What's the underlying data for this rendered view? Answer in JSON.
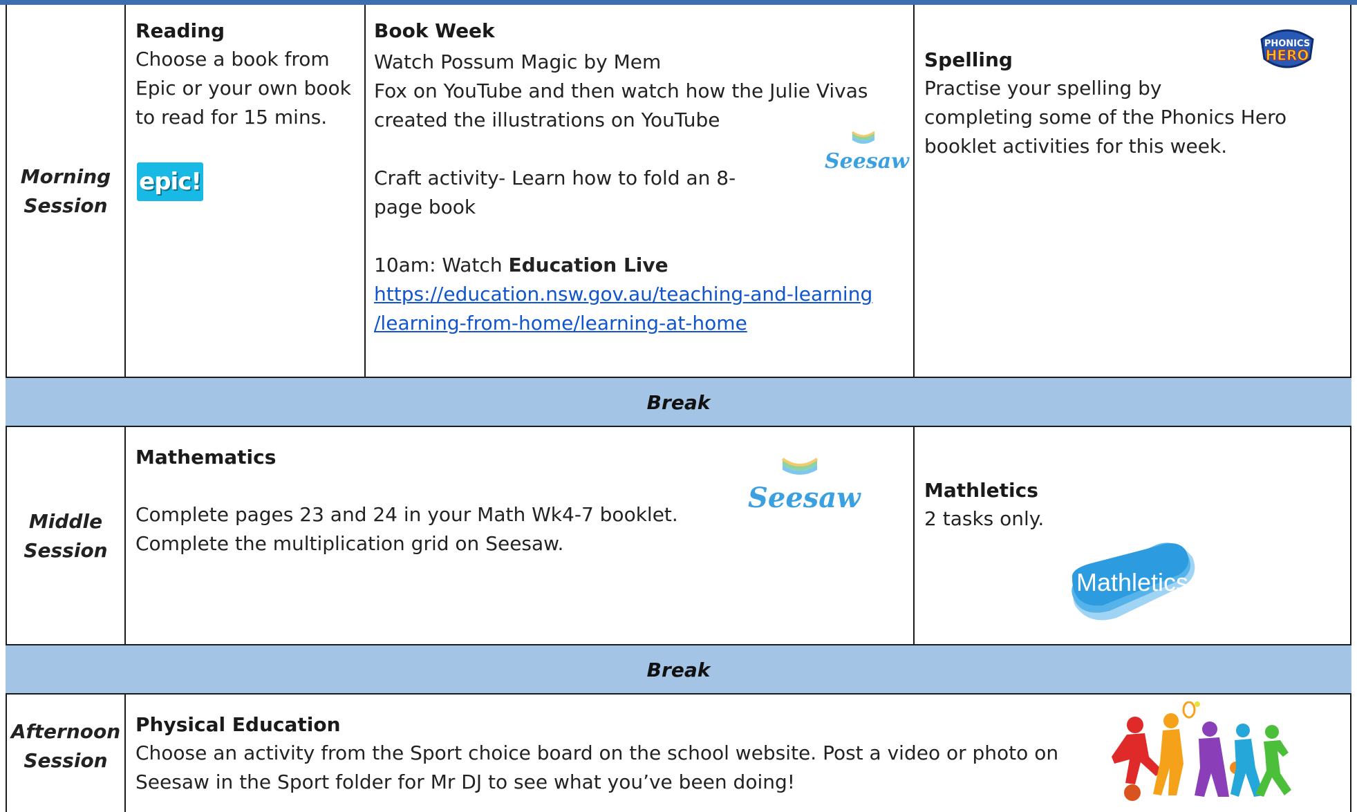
{
  "rows": {
    "morning": {
      "session_label": [
        "Morning",
        "Session"
      ],
      "reading": {
        "heading": "Reading",
        "lines": [
          "Choose a book from",
          "Epic or your own book",
          "to read for 15 mins."
        ],
        "logo_text": "epic!"
      },
      "book_week": {
        "heading": "Book Week",
        "para1": [
          "Watch Possum Magic by Mem",
          "Fox on YouTube and then watch how the Julie Vivas",
          "created the illustrations on YouTube"
        ],
        "para2": [
          "Craft activity- Learn how to fold an 8-",
          "page book"
        ],
        "live_prefix": "10am: Watch ",
        "live_bold": "Education Live",
        "link_lines": [
          "https://education.nsw.gov.au/teaching-and-learning",
          "/learning-from-home/learning-at-home"
        ],
        "logo_text": "Seesaw"
      },
      "spelling": {
        "heading": "Spelling",
        "lines": [
          "Practise your spelling by",
          "completing some of the Phonics Hero",
          "booklet activities for this week."
        ],
        "logo_text": [
          "PHONICS",
          "HERO"
        ]
      }
    },
    "break1": "Break",
    "middle": {
      "session_label": [
        "Middle",
        "Session"
      ],
      "mathematics": {
        "heading": "Mathematics",
        "lines": [
          "Complete pages 23 and 24 in your Math Wk4-7 booklet.",
          "Complete the multiplication grid on Seesaw."
        ],
        "logo_text": "Seesaw"
      },
      "mathletics": {
        "heading": "Mathletics",
        "lines": [
          "2 tasks only."
        ],
        "logo_text": "Mathletics"
      }
    },
    "break2": "Break",
    "afternoon": {
      "session_label": [
        "Afternoon",
        "Session"
      ],
      "pe": {
        "heading": "Physical Education",
        "lines": [
          "Choose an activity from the Sport choice board on the school website. Post a video or photo on",
          "Seesaw in the Sport folder for Mr DJ to see what you’ve been doing!"
        ]
      }
    }
  },
  "colors": {
    "break_band": "#a3c4e5",
    "top_bar": "#3d6fb0",
    "link": "#1155cc",
    "seesaw": "#3aa0e0",
    "epic_bg": "#19b9e6"
  }
}
